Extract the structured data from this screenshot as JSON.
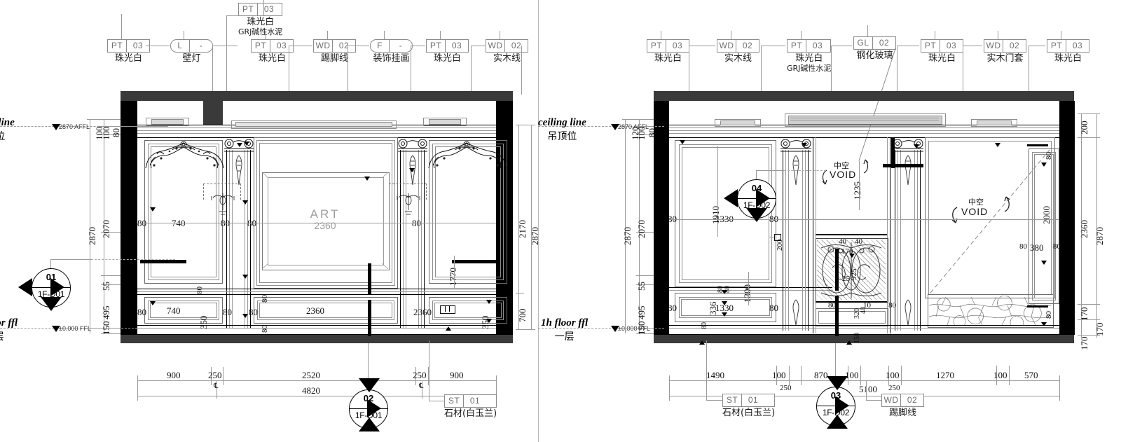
{
  "drawing": {
    "type": "interior-elevation-cad",
    "sheet_ids": [
      "1F-D01",
      "1F-D02"
    ],
    "panels": [
      {
        "id": "left",
        "detail_tag": "01",
        "sheet": "1F-D01"
      },
      {
        "id": "right",
        "detail_tag": "03",
        "sheet": "1F-D02"
      }
    ]
  },
  "levels": {
    "ceiling_en": "ceiling line",
    "ceiling_cn": "吊顶位",
    "ceiling_value": "2870 AFFL",
    "floor_en": "1h floor ffl",
    "floor_cn": "一层",
    "floor_value": "±0.000 FFL"
  },
  "left_panel": {
    "tags": [
      {
        "code": "PT",
        "num": "03",
        "name": "珠光白",
        "name2": "",
        "shape": "rect"
      },
      {
        "code": "L",
        "num": "-",
        "name": "壁灯",
        "name2": "",
        "shape": "oval"
      },
      {
        "code": "PT",
        "num": "03",
        "name": "珠光白",
        "name2": "GRJ碱性水泥",
        "shape": "rect"
      },
      {
        "code": "PT",
        "num": "03",
        "name": "珠光白",
        "name2": "",
        "shape": "rect"
      },
      {
        "code": "WD",
        "num": "02",
        "name": "踢脚线",
        "name2": "",
        "shape": "rect"
      },
      {
        "code": "F",
        "num": "-",
        "name": "装饰挂画",
        "name2": "",
        "shape": "oval"
      },
      {
        "code": "PT",
        "num": "03",
        "name": "珠光白",
        "name2": "",
        "shape": "rect"
      },
      {
        "code": "WD",
        "num": "02",
        "name": "实木线",
        "name2": "",
        "shape": "rect"
      }
    ],
    "bottom_tag": {
      "code": "ST",
      "num": "01",
      "name": "石材(白玉兰)"
    },
    "bubbles": [
      {
        "id": "01",
        "sheet": "1F-D01"
      },
      {
        "id": "02",
        "sheet": "1F-D01"
      }
    ],
    "vdims_left": [
      "100",
      "100",
      "80",
      "2070",
      "2870",
      "55",
      "495",
      "150"
    ],
    "vdims_right": [
      "2170",
      "2870",
      "700"
    ],
    "hdims_upper": [
      "900",
      "250",
      "2520",
      "250",
      "900"
    ],
    "hdims_total": "4820",
    "panel_notes": [
      "740",
      "80",
      "80",
      "80",
      "80",
      "1770",
      "2360",
      "740",
      "350",
      "350",
      "80",
      "80",
      "80"
    ],
    "art_label": "ART",
    "art_size": "2360",
    "lower_panel_width": "2360"
  },
  "right_panel": {
    "tags": [
      {
        "code": "PT",
        "num": "03",
        "name": "珠光白",
        "name2": "",
        "shape": "rect"
      },
      {
        "code": "WD",
        "num": "02",
        "name": "实木线",
        "name2": "",
        "shape": "rect"
      },
      {
        "code": "PT",
        "num": "03",
        "name": "珠光白",
        "name2": "GRJ碱性水泥",
        "shape": "rect"
      },
      {
        "code": "GL",
        "num": "02",
        "name": "钢化玻璃",
        "name2": "",
        "shape": "rect"
      },
      {
        "code": "PT",
        "num": "03",
        "name": "珠光白",
        "name2": "",
        "shape": "rect"
      },
      {
        "code": "WD",
        "num": "02",
        "name": "实木门套",
        "name2": "",
        "shape": "rect"
      },
      {
        "code": "PT",
        "num": "03",
        "name": "珠光白",
        "name2": "",
        "shape": "rect"
      }
    ],
    "bottom_tags": [
      {
        "code": "ST",
        "num": "01",
        "name": "石材(白玉兰)"
      },
      {
        "code": "WD",
        "num": "02",
        "name": "踢脚线"
      }
    ],
    "bubbles": [
      {
        "id": "04",
        "sheet": "1F-D02"
      },
      {
        "id": "03",
        "sheet": "1F-D02"
      }
    ],
    "void_en": "VOID",
    "void_cn": "中空",
    "vdims_left": [
      "100",
      "120",
      "80",
      "2070",
      "2870",
      "55",
      "495",
      "150"
    ],
    "vdims_right": [
      "200",
      "2360",
      "2870",
      "170",
      "170",
      "170"
    ],
    "hdims_upper": [
      "1490",
      "100",
      "870",
      "100",
      "100",
      "1270",
      "100",
      "570"
    ],
    "hdims_mid": [
      "250",
      "250"
    ],
    "hdims_total": "5100",
    "panel_notes": [
      "1910",
      "1330",
      "80",
      "80",
      "1300",
      "1330",
      "336",
      "80",
      "80",
      "25",
      "200",
      "40",
      "40",
      "170",
      "1235",
      "925",
      "320",
      "40",
      "10",
      "150",
      "2000",
      "380",
      "80",
      "80",
      "80"
    ]
  },
  "colors": {
    "line": "#000000",
    "thin_line": "#9a9a9a",
    "tag_stroke": "#8b8b8b",
    "wall_fill": "#000000",
    "ceiling_fill": "#3a3a3a",
    "art_text": "#9c9c9c"
  }
}
